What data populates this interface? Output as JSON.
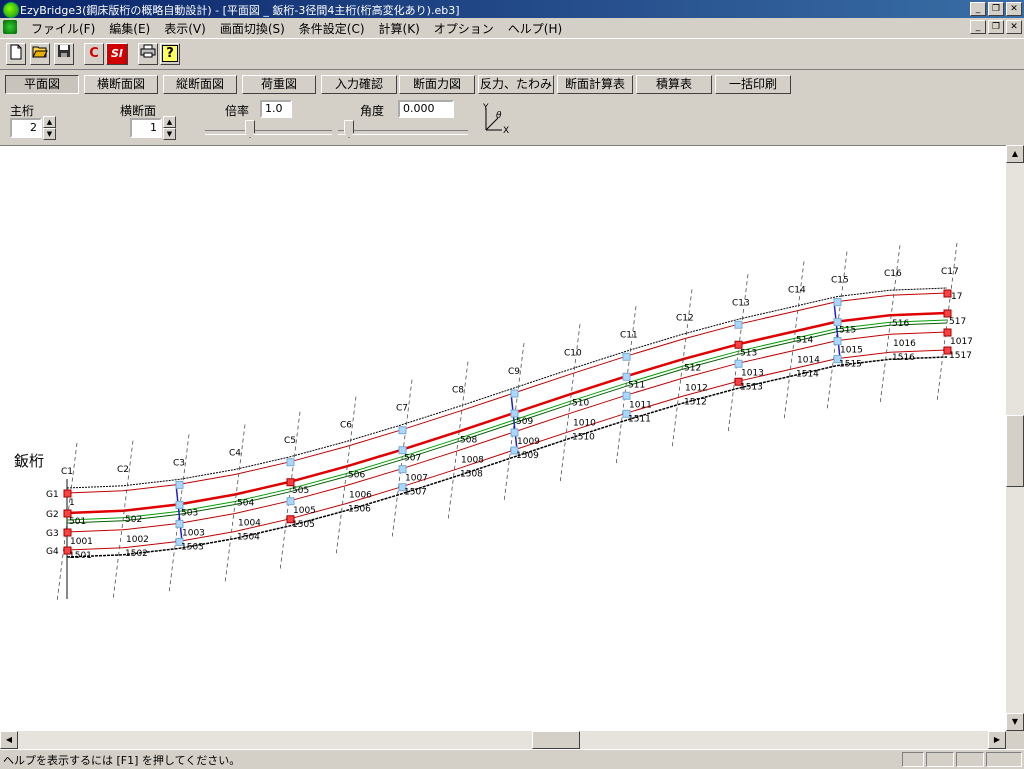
{
  "window": {
    "title": "EzyBridge3(鋼床版桁の概略自動設計) - [平面図 _ 鈑桁-3径間4主桁(桁高変化あり).eb3]",
    "minimize": "_",
    "restore": "❐",
    "close": "✕"
  },
  "menu": {
    "items": [
      "ファイル(F)",
      "編集(E)",
      "表示(V)",
      "画面切換(S)",
      "条件設定(C)",
      "計算(K)",
      "オプション",
      "ヘルプ(H)"
    ]
  },
  "toolbar": {
    "buttons": [
      {
        "name": "new-file-icon",
        "glyph": "🗋"
      },
      {
        "name": "open-folder-icon",
        "glyph": "📂"
      },
      {
        "name": "save-disk-icon",
        "glyph": "💾"
      },
      {
        "name": "c-calc-icon",
        "glyph": "C"
      },
      {
        "name": "si-unit-icon",
        "glyph": "SI"
      },
      {
        "name": "print-icon",
        "glyph": "🖶"
      },
      {
        "name": "help-icon",
        "glyph": "?"
      }
    ]
  },
  "tabs": [
    "平面図",
    "横断面図",
    "縦断面図",
    "荷重図",
    "入力確認",
    "断面力図",
    "反力、たわみ",
    "断面計算表",
    "積算表",
    "一括印刷"
  ],
  "controls": {
    "main_girder_label": "主桁",
    "main_girder_value": "2",
    "cross_section_label": "横断面",
    "cross_section_value": "1",
    "scale_label": "倍率",
    "scale_value": "1.0",
    "angle_label": "角度",
    "angle_value": "0.000",
    "axis_y": "Y",
    "axis_theta": "θ",
    "axis_x": "X"
  },
  "drawing": {
    "type_label": "鈑桁",
    "girder_labels": [
      "G1",
      "G2",
      "G3",
      "G4"
    ],
    "cross_beam_labels": [
      "C1",
      "C2",
      "C3",
      "C4",
      "C5",
      "C6",
      "C7",
      "C8",
      "C9",
      "C10",
      "C11",
      "C12",
      "C13",
      "C14",
      "C15",
      "C16",
      "C17"
    ],
    "node_labels_g1": [
      "1",
      "17"
    ],
    "node_labels_g2": [
      "501",
      "502",
      "503",
      "504",
      "505",
      "506",
      "507",
      "508",
      "509",
      "510",
      "511",
      "512",
      "513",
      "514",
      "515",
      "516",
      "517"
    ],
    "node_labels_g3": [
      "1001",
      "1002",
      "1003",
      "1004",
      "1005",
      "1006",
      "1007",
      "1008",
      "1009",
      "1010",
      "1011",
      "1012",
      "1013",
      "1014",
      "1015",
      "1016",
      "1017"
    ],
    "node_labels_g4": [
      "1501",
      "1502",
      "1503",
      "1504",
      "1505",
      "1506",
      "1507",
      "1508",
      "1509",
      "1510",
      "1511",
      "1512",
      "1513",
      "1514",
      "1515",
      "1516",
      "1517"
    ]
  },
  "status": {
    "text": "ヘルプを表示するには [F1] を押してください。"
  },
  "colors": {
    "titlebar": "#0a246a",
    "main_girder": "#e00000",
    "girder_line": "#c00000",
    "cross_beam": "#1f1fd0",
    "green_line": "#00a000"
  }
}
